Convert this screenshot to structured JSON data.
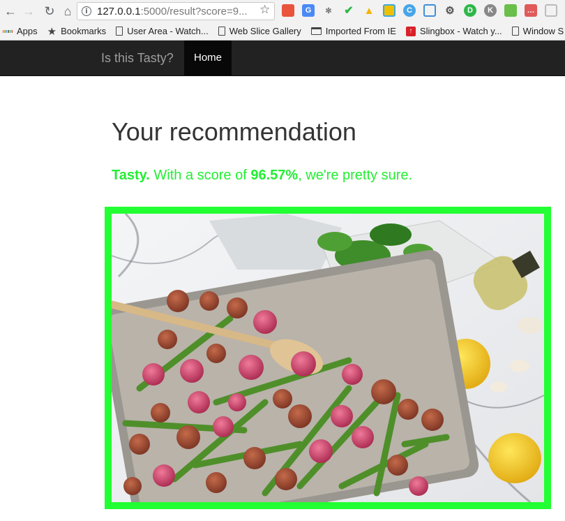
{
  "browser": {
    "url_host": "127.0.0.1",
    "url_rest": ":5000/result?score=9...",
    "bookmarks": [
      {
        "label": "Apps",
        "icon": "apps-grid-icon"
      },
      {
        "label": "Bookmarks",
        "icon": "star-icon"
      },
      {
        "label": "User Area - Watch...",
        "icon": "page-icon"
      },
      {
        "label": "Web Slice Gallery",
        "icon": "page-icon"
      },
      {
        "label": "Imported From IE",
        "icon": "folder-icon"
      },
      {
        "label": "Slingbox - Watch y...",
        "icon": "slingbox-icon"
      },
      {
        "label": "Window S",
        "icon": "page-icon"
      }
    ]
  },
  "navbar": {
    "brand": "Is this Tasty?",
    "home": "Home"
  },
  "page": {
    "title": "Your recommendation",
    "verdict_label": "Tasty.",
    "verdict_prefix": " With a score of ",
    "score": "96.57%",
    "verdict_suffix": ", we're pretty sure.",
    "accent_color": "#22ee33"
  },
  "photo": {
    "alt": "Roasted radishes and asparagus on a sheet pan"
  }
}
